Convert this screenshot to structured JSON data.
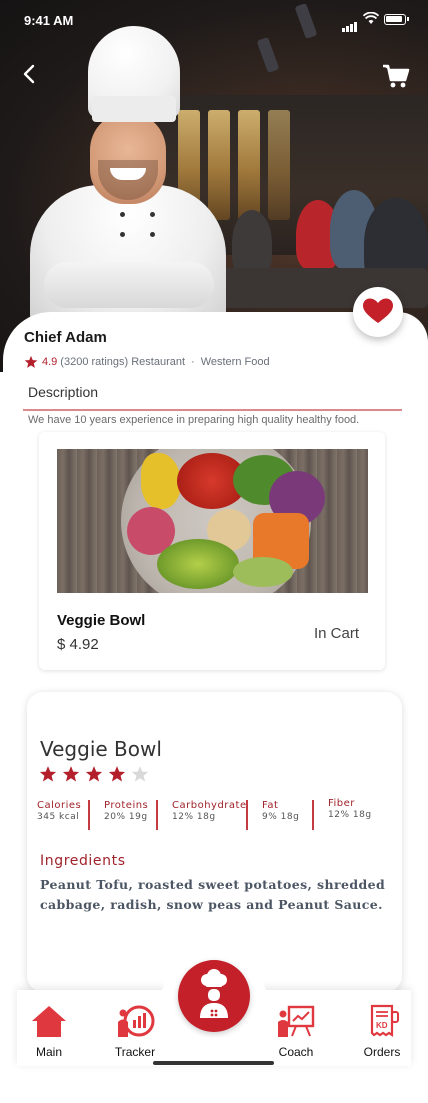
{
  "status_bar": {
    "time": "9:41 AM"
  },
  "colors": {
    "accent": "#c4202a",
    "star_active": "#b3202b",
    "star_inactive": "#d9d9d9"
  },
  "header": {
    "back_icon": "chevron-left-icon",
    "cart_icon": "cart-icon",
    "favorite_icon": "heart-icon"
  },
  "chef": {
    "name": "Chief Adam",
    "rating": "4.9",
    "ratings_count": "(3200 ratings) Restaurant",
    "separator": "·",
    "cuisine": "Western Food"
  },
  "description": {
    "title": "Description",
    "text": "We have 10 years experience in preparing high quality healthy food."
  },
  "product": {
    "name": "Veggie Bowl",
    "price": "$ 4.92",
    "status": "In Cart"
  },
  "detail": {
    "title": "Veggie Bowl",
    "stars_filled": 4,
    "stars_total": 5,
    "nutrition": [
      {
        "label": "Calories",
        "value": "345 kcal"
      },
      {
        "label": "Proteins",
        "value": "20% 19g"
      },
      {
        "label": "Carbohydrate",
        "value": "12% 18g"
      },
      {
        "label": "Fat",
        "value": "9% 18g"
      },
      {
        "label": "Fiber",
        "value": "12% 18g"
      }
    ],
    "ingredients_title": "Ingredients",
    "ingredients_text": "Peanut Tofu, roasted sweet potatoes, shredded cabbage, radish, snow peas and Peanut Sauce."
  },
  "nav": {
    "items": [
      {
        "label": "Main",
        "icon": "home-icon"
      },
      {
        "label": "Tracker",
        "icon": "tracker-chart-icon"
      },
      {
        "label": "",
        "icon": "chef-icon"
      },
      {
        "label": "Coach",
        "icon": "coach-board-icon"
      },
      {
        "label": "Orders",
        "icon": "orders-receipt-icon"
      }
    ]
  }
}
